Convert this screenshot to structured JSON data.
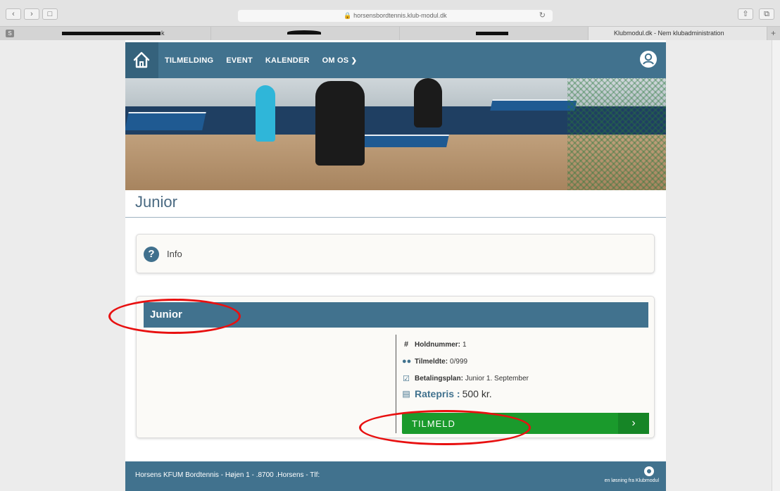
{
  "browser": {
    "url": "horsensbordtennis.klub-modul.dk",
    "tab_favicon": "S",
    "active_tab_title": "Klubmodul.dk - Nem klubadministration",
    "tab_partial_letter": "k"
  },
  "nav": {
    "items": [
      "TILMELDING",
      "EVENT",
      "KALENDER",
      "OM OS"
    ],
    "home_icon": "home-icon",
    "user_icon": "user-icon",
    "dropdown_icon": "chevron-down-icon"
  },
  "page": {
    "title": "Junior"
  },
  "info": {
    "label": "Info",
    "icon": "question-circle-icon"
  },
  "team": {
    "name": "Junior",
    "holdnummer_label": "Holdnummer:",
    "holdnummer_value": "1",
    "tilmeldte_label": "Tilmeldte:",
    "tilmeldte_value": "0/999",
    "betalingsplan_label": "Betalingsplan:",
    "betalingsplan_value": "Junior 1. September",
    "ratepris_label": "Ratepris :",
    "ratepris_value": "500 kr.",
    "signup_label": "TILMELD"
  },
  "footer": {
    "text": "Horsens KFUM Bordtennis - Højen 1 - .8700 .Horsens - Tlf:",
    "brand": "en løsning fra Klubmodul"
  },
  "colors": {
    "brand_blue": "#41728e",
    "signup_green": "#1a9a2c",
    "annotation_red": "#e81010"
  }
}
